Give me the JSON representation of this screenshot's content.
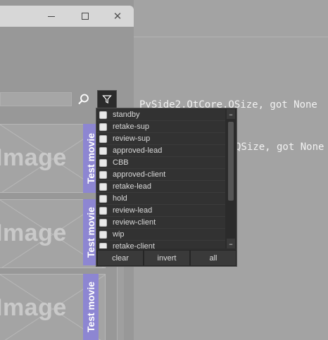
{
  "window": {
    "minimize_label": "minimize",
    "maximize_label": "maximize",
    "close_symbol": "✕"
  },
  "console": {
    "lines": [
      "PySide2.QtCore.QSize, got None",
      "QSize, got None"
    ]
  },
  "toolbar": {
    "search_icon": "search-icon",
    "filter_icon": "filter-icon"
  },
  "cards": [
    {
      "image_text": "Image",
      "tag": "Test movie"
    },
    {
      "image_text": "Image",
      "tag": "Test movie"
    },
    {
      "image_text": "Image",
      "tag": "Test movie"
    }
  ],
  "filter_popup": {
    "items": [
      "standby",
      "retake-sup",
      "review-sup",
      "approved-lead",
      "CBB",
      "approved-client",
      "retake-lead",
      "hold",
      "review-lead",
      "review-client",
      "wip",
      "retake-client"
    ],
    "buttons": {
      "clear": "clear",
      "invert": "invert",
      "all": "all"
    }
  },
  "colors": {
    "movie_tag": "#8d86d2",
    "popup_bg": "#2e2e2e",
    "console_text": "#f2f2f2"
  }
}
